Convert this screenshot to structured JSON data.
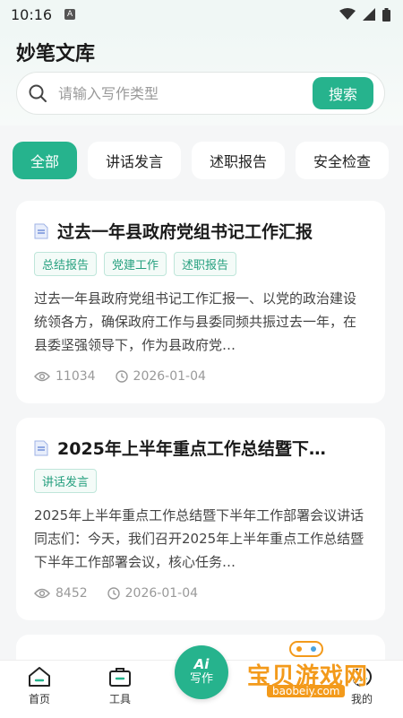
{
  "status": {
    "time": "10:16",
    "notif_glyph": "A"
  },
  "app": {
    "title": "妙笔文库"
  },
  "search": {
    "placeholder": "请输入写作类型",
    "button": "搜索"
  },
  "tabs": [
    {
      "label": "全部",
      "active": true
    },
    {
      "label": "讲话发言",
      "active": false
    },
    {
      "label": "述职报告",
      "active": false
    },
    {
      "label": "安全检查",
      "active": false
    }
  ],
  "cards": [
    {
      "title": "过去一年县政府党组书记工作汇报",
      "tags": [
        "总结报告",
        "党建工作",
        "述职报告"
      ],
      "desc": "过去一年县政府党组书记工作汇报一、以党的政治建设统领各方，确保政府工作与县委同频共振过去一年，在县委坚强领导下，作为县政府党…",
      "views": "11034",
      "date": "2026-01-04"
    },
    {
      "title": "2025年上半年重点工作总结暨下…",
      "tags": [
        "讲话发言"
      ],
      "desc": "2025年上半年重点工作总结暨下半年工作部署会议讲话同志们：今天，我们召开2025年上半年重点工作总结暨下半年工作部署会议，核心任务…",
      "views": "8452",
      "date": "2026-01-04"
    }
  ],
  "nav": {
    "home": "首页",
    "tools": "工具",
    "write_ai": "Ai",
    "write": "写作",
    "mine": "我的"
  },
  "watermark": {
    "text": "宝贝游戏网",
    "url": "baobeiy.com"
  },
  "colors": {
    "accent": "#26b38d",
    "tag_text": "#26a07f",
    "watermark": "#f39a1b"
  }
}
